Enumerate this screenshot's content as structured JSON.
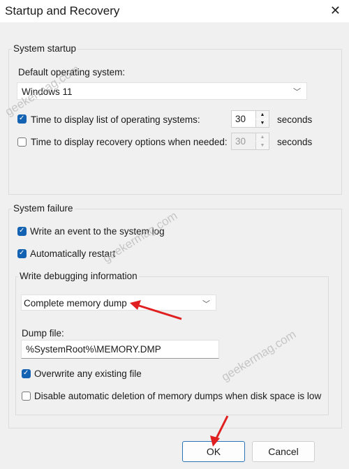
{
  "window": {
    "title": "Startup and Recovery",
    "close_icon": "close-icon"
  },
  "system_startup": {
    "legend": "System startup",
    "default_os_label": "Default operating system:",
    "default_os_value": "Windows 11",
    "display_list": {
      "label": "Time to display list of operating systems:",
      "checked": true,
      "value": "30",
      "unit": "seconds"
    },
    "display_recovery": {
      "label": "Time to display recovery options when needed:",
      "checked": false,
      "value": "30",
      "unit": "seconds"
    }
  },
  "system_failure": {
    "legend": "System failure",
    "write_event": {
      "label": "Write an event to the system log",
      "checked": true
    },
    "auto_restart": {
      "label": "Automatically restart",
      "checked": true
    },
    "debugging": {
      "legend": "Write debugging information",
      "dump_type": "Complete memory dump",
      "dump_file_label": "Dump file:",
      "dump_file_value": "%SystemRoot%\\MEMORY.DMP",
      "overwrite": {
        "label": "Overwrite any existing file",
        "checked": true
      },
      "disable_auto_delete": {
        "label": "Disable automatic deletion of memory dumps when disk space is low",
        "checked": false
      }
    }
  },
  "buttons": {
    "ok": "OK",
    "cancel": "Cancel"
  },
  "watermark": "geekermag.com",
  "accent": "#1463b3",
  "annotation_color": "#e02020"
}
